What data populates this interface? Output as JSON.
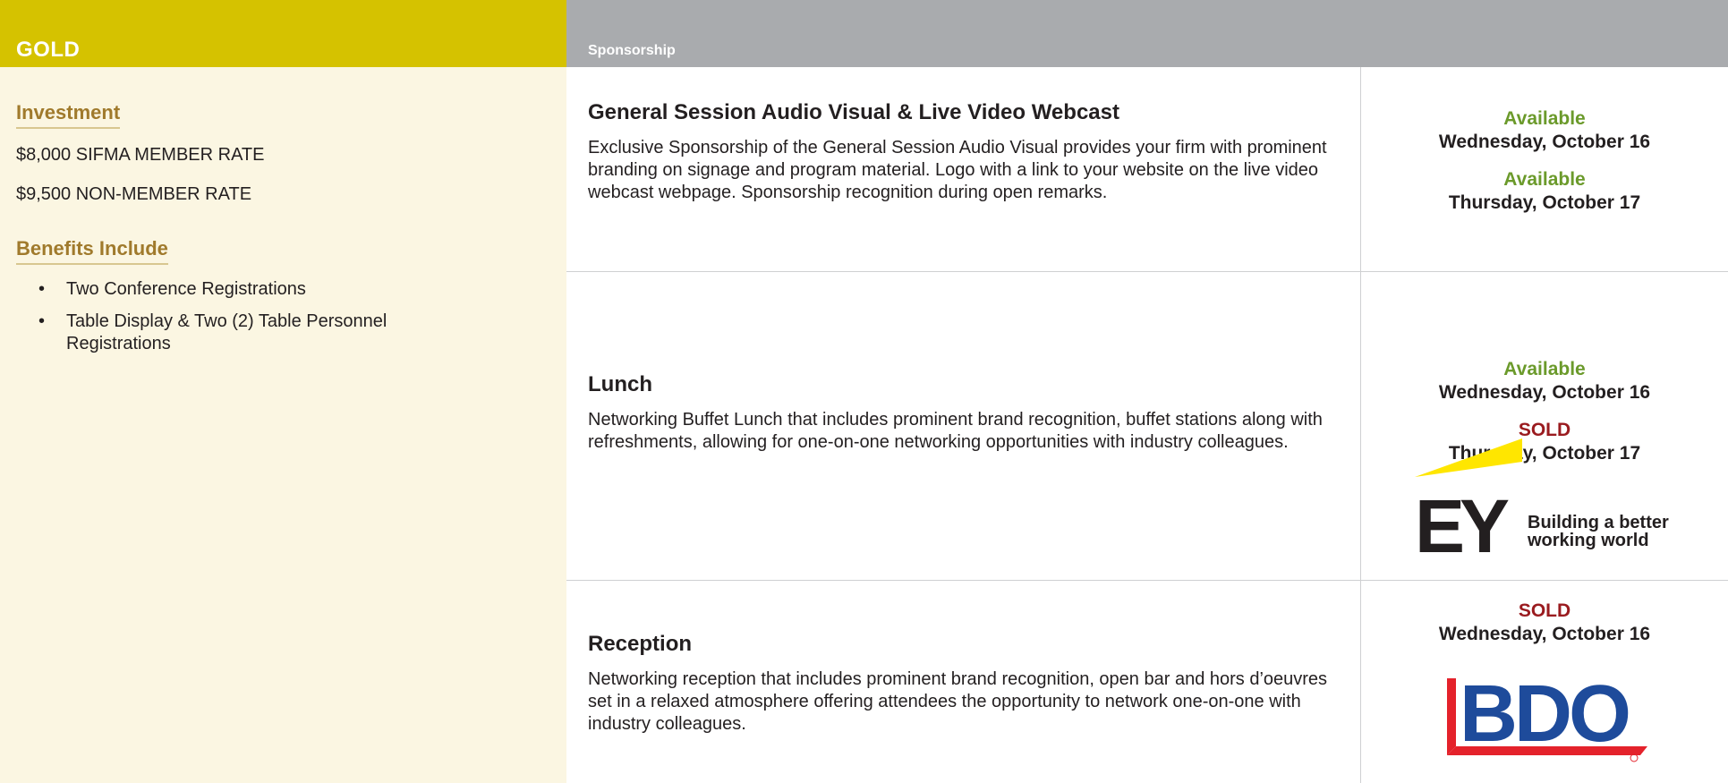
{
  "header": {
    "tier": "GOLD",
    "column_label": "Sponsorship"
  },
  "left": {
    "investment_title": "Investment",
    "member_rate": "$8,000 SIFMA MEMBER RATE",
    "non_member_rate": "$9,500 NON-MEMBER RATE",
    "benefits_title": "Benefits Include",
    "benefits": [
      "Two Conference Registrations",
      "Table Display & Two (2) Table Personnel Registrations"
    ],
    "bullet_glyph": "•"
  },
  "rows": [
    {
      "title": "General Session Audio Visual & Live Video Webcast",
      "description": "Exclusive Sponsorship of the General Session Audio Visual provides your firm with prominent branding on signage and program material. Logo with a link to your website on the live video webcast webpage. Sponsorship recognition during open remarks.",
      "slots": [
        {
          "status": "Available",
          "day": "Wednesday, October 16"
        },
        {
          "status": "Available",
          "day": "Thursday, October 17"
        }
      ]
    },
    {
      "title": "Lunch",
      "description": "Networking Buffet Lunch that includes prominent brand recognition, buffet stations along with refreshments, allowing for one-on-one networking opportunities with industry colleagues.",
      "slots": [
        {
          "status": "Available",
          "day": "Wednesday, October 16"
        },
        {
          "status": "SOLD",
          "day": "Thursday, October 17"
        }
      ],
      "logo": {
        "brand": "EY",
        "tagline_line1": "Building a better",
        "tagline_line2": "working world"
      }
    },
    {
      "title": "Reception",
      "description": "Networking reception that includes prominent brand recognition, open bar and hors d’oeuvres set in a relaxed atmosphere offering attendees the opportunity to network one-on-one with industry colleagues.",
      "slots": [
        {
          "status": "SOLD",
          "day": "Wednesday, October 16"
        }
      ],
      "logo": {
        "brand": "BDO"
      }
    }
  ],
  "colors": {
    "gold": "#d5c200",
    "header_gray": "#a9abae",
    "left_bg": "#fbf6e2",
    "section_title": "#a07a2c",
    "available": "#6b9a2b",
    "sold": "#9a1b1f",
    "ey_yellow": "#ffe600",
    "bdo_blue": "#1e4b9b",
    "bdo_red": "#e4222b"
  }
}
